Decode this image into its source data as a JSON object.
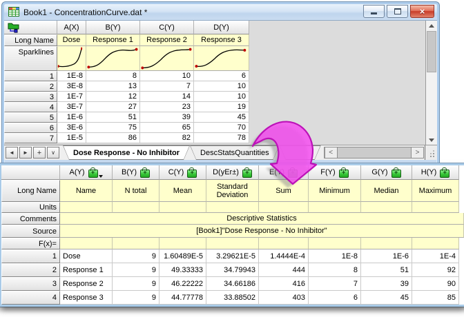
{
  "window1": {
    "title": "Book1 - ConcentrationCurve.dat *",
    "titlebar_buttons": {
      "minimize": "minimize",
      "restore": "restore",
      "close": "close"
    },
    "columns": [
      "A(X)",
      "B(Y)",
      "C(Y)",
      "D(Y)"
    ],
    "long_name_label": "Long Name",
    "sparklines_label": "Sparklines",
    "long_names": [
      "Dose",
      "Response 1",
      "Response 2",
      "Response 3"
    ],
    "data_rows": [
      [
        "1",
        "1E-8",
        "8",
        "10",
        "6"
      ],
      [
        "2",
        "3E-8",
        "13",
        "7",
        "10"
      ],
      [
        "3",
        "1E-7",
        "12",
        "14",
        "10"
      ],
      [
        "4",
        "3E-7",
        "27",
        "23",
        "19"
      ],
      [
        "5",
        "1E-6",
        "51",
        "39",
        "45"
      ],
      [
        "6",
        "3E-6",
        "75",
        "65",
        "70"
      ],
      [
        "7",
        "1E-5",
        "86",
        "82",
        "78"
      ]
    ],
    "tabs": [
      {
        "label": "Dose Response - No Inhibitor",
        "active": true
      },
      {
        "label": "DescStatsQuantities",
        "active": false
      }
    ]
  },
  "window2": {
    "columns": [
      "A(Y)",
      "B(Y)",
      "C(Y)",
      "D(yEr±)",
      "E(Y)",
      "F(Y)",
      "G(Y)",
      "H(Y)"
    ],
    "row_labels": [
      "Long Name",
      "Units",
      "Comments",
      "Source",
      "F(x)="
    ],
    "long_names": [
      "Name",
      "N total",
      "Mean",
      "Standard Deviation",
      "Sum",
      "Minimum",
      "Median",
      "Maximum"
    ],
    "comments_value": "Descriptive Statistics",
    "source_value": "[Book1]\"Dose Response - No Inhibitor\"",
    "data_rows": [
      [
        "1",
        "Dose",
        "9",
        "1.60489E-5",
        "3.29621E-5",
        "1.4444E-4",
        "1E-8",
        "1E-6",
        "1E-4"
      ],
      [
        "2",
        "Response 1",
        "9",
        "49.33333",
        "34.79943",
        "444",
        "8",
        "51",
        "92"
      ],
      [
        "3",
        "Response 2",
        "9",
        "46.22222",
        "34.66186",
        "416",
        "7",
        "39",
        "90"
      ],
      [
        "4",
        "Response 3",
        "9",
        "44.77778",
        "33.88502",
        "403",
        "6",
        "45",
        "85"
      ]
    ]
  },
  "icons": {
    "titlebar": "worksheet-grid-icon",
    "sheet_corner": "workbook-organizer-icon",
    "column_lock": "recalculate-lock-icon",
    "arrow": "pink-callout-arrow"
  },
  "colors": {
    "arrow_pink": "#F551F0",
    "header_yellow": "#FFFFCC",
    "titlebar_blue": "#C7DBF1",
    "lock_green": "#39C839",
    "close_red": "#C83C28"
  }
}
